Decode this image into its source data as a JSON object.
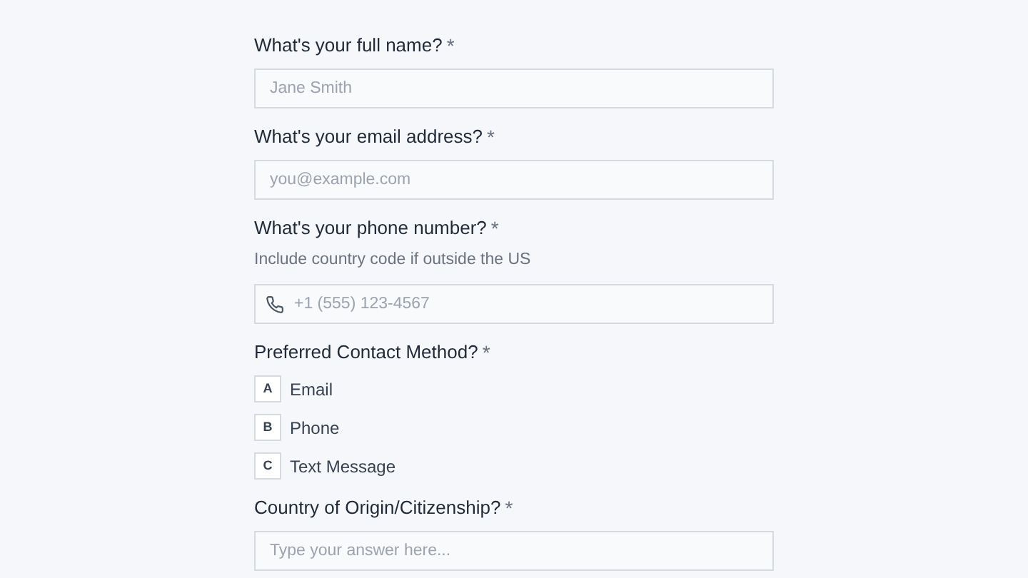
{
  "questions": [
    {
      "kind": "text",
      "label": "What's your full name?",
      "required_mark": "*",
      "placeholder": "Jane Smith"
    },
    {
      "kind": "text",
      "label": "What's your email address?",
      "required_mark": "*",
      "placeholder": "you@example.com"
    },
    {
      "kind": "phone",
      "label": "What's your phone number?",
      "required_mark": "*",
      "hint": "Include country code if outside the US",
      "placeholder": "+1 (555) 123-4567"
    },
    {
      "kind": "choice",
      "label": "Preferred Contact Method?",
      "required_mark": "*",
      "options": [
        {
          "key": "A",
          "label": "Email",
          "selected": false
        },
        {
          "key": "B",
          "label": "Phone",
          "selected": false
        },
        {
          "key": "C",
          "label": "Text Message",
          "selected": false
        }
      ]
    },
    {
      "kind": "text",
      "label": "Country of Origin/Citizenship?",
      "required_mark": "*",
      "placeholder": "Type your answer here..."
    }
  ]
}
